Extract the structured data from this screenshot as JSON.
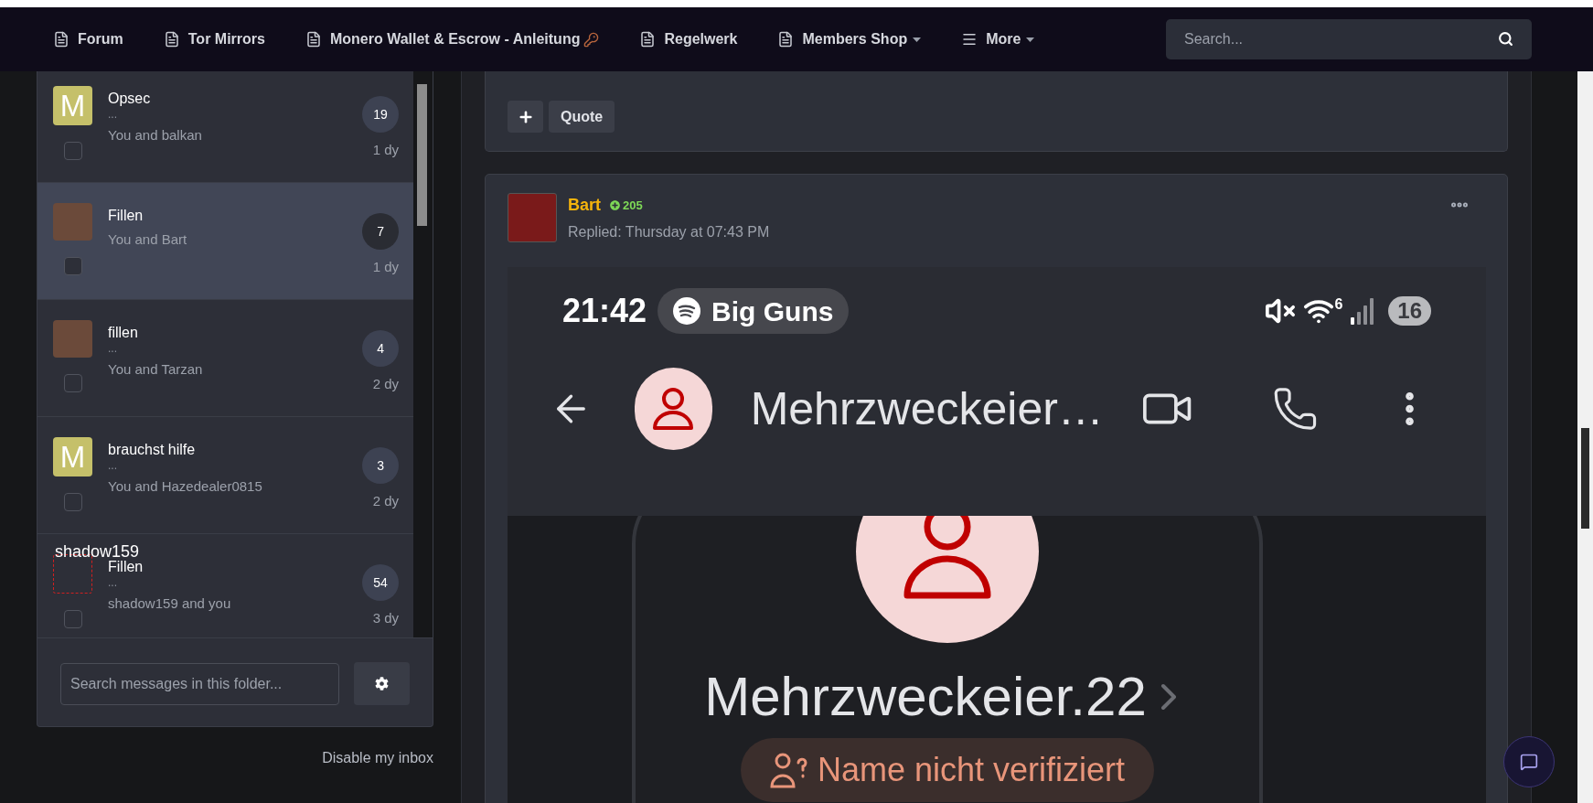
{
  "nav": {
    "items": [
      {
        "label": "Forum",
        "kind": "page",
        "dropdown": false,
        "key_mark": false
      },
      {
        "label": "Tor Mirrors",
        "kind": "page",
        "dropdown": false,
        "key_mark": false
      },
      {
        "label": "Monero Wallet & Escrow - Anleitung",
        "kind": "page",
        "dropdown": false,
        "key_mark": true
      },
      {
        "label": "Regelwerk",
        "kind": "page",
        "dropdown": false,
        "key_mark": false
      },
      {
        "label": "Members Shop",
        "kind": "page",
        "dropdown": true,
        "key_mark": false
      },
      {
        "label": "More",
        "kind": "menu",
        "dropdown": true,
        "key_mark": false
      }
    ],
    "search": {
      "placeholder": "Search..."
    }
  },
  "conversations": {
    "items": [
      {
        "title": "Opsec",
        "avatar": {
          "kind": "letter",
          "letter": "M"
        },
        "preview": "...",
        "participants": "You and balkan",
        "count": "19",
        "age": "1 dy",
        "selected": false,
        "checked": false
      },
      {
        "title": "Fillen",
        "avatar": {
          "kind": "photo"
        },
        "participants": "You and Bart",
        "count": "7",
        "age": "1 dy",
        "selected": true,
        "checked": false
      },
      {
        "title": "fillen",
        "avatar": {
          "kind": "photo"
        },
        "preview": "...",
        "participants": "You and Tarzan",
        "count": "4",
        "age": "2 dy",
        "selected": false,
        "checked": false
      },
      {
        "title": "brauchst hilfe",
        "avatar": {
          "kind": "letter",
          "letter": "M"
        },
        "preview": "...",
        "participants": "You and Hazedealer0815",
        "count": "3",
        "age": "2 dy",
        "selected": false,
        "checked": false
      },
      {
        "title": "Fillen",
        "avatar": {
          "kind": "broken",
          "alt": "shadow159"
        },
        "preview": "...",
        "participants": "shadow159 and you",
        "count": "54",
        "age": "3 dy",
        "selected": false,
        "checked": false
      }
    ],
    "search": {
      "placeholder": "Search messages in this folder..."
    },
    "footer_link": "Disable my inbox"
  },
  "thread": {
    "actions": [
      {
        "kind": "icon"
      },
      {
        "kind": "text",
        "label": "Quote"
      }
    ],
    "post": {
      "author": "Bart",
      "reputation": "205",
      "meta": "Replied: Thursday at 07:43 PM",
      "screenshot": {
        "time": "21:42",
        "now_playing": "Big Guns",
        "wifi_label": "6",
        "battery": "16",
        "header_title": "Mehrzweckeier…",
        "contact_name": "Mehrzweckeier.22",
        "verification": "Name nicht verifiziert"
      }
    }
  }
}
